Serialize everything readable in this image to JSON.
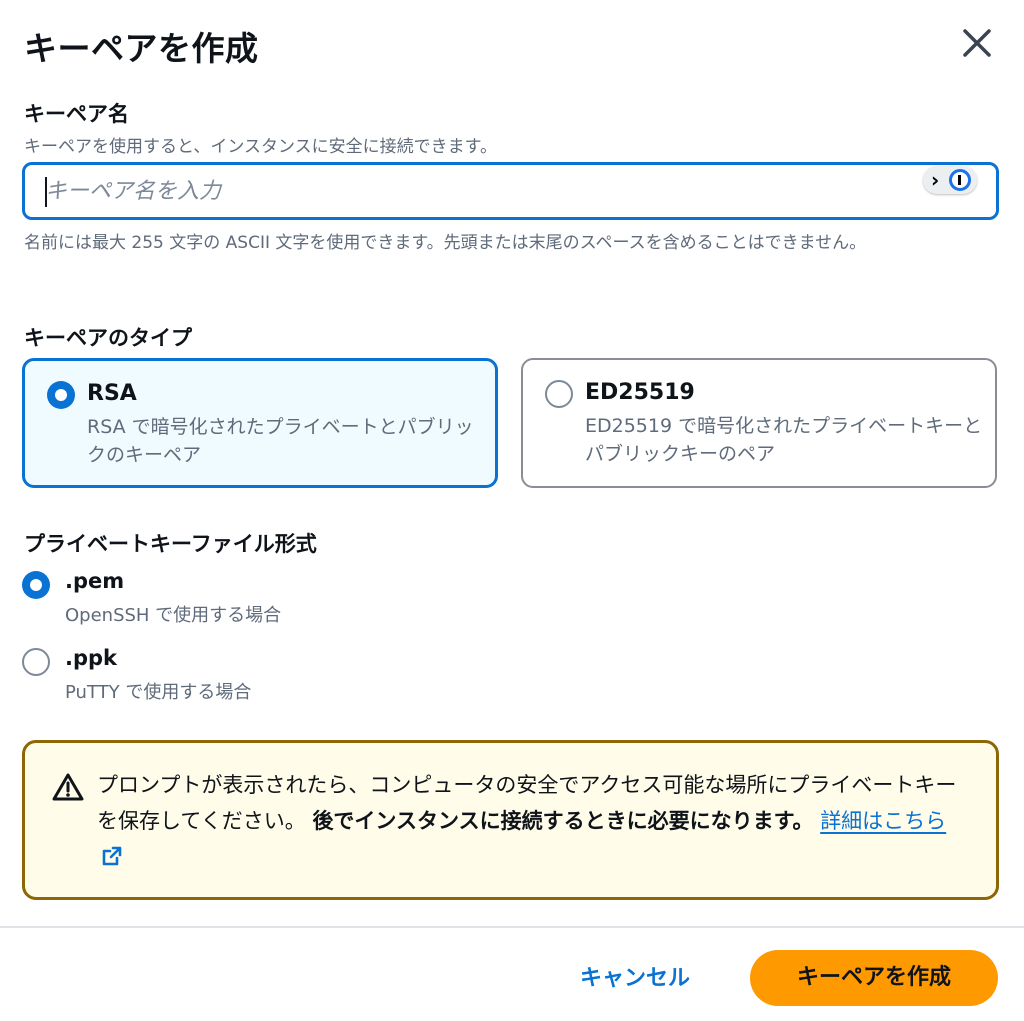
{
  "dialog": {
    "title": "キーペアを作成",
    "close_icon": "close-icon"
  },
  "key_name": {
    "label": "キーペア名",
    "description": "キーペアを使用すると、インスタンスに安全に接続できます。",
    "value": "",
    "placeholder": "キーペア名を入力",
    "constraint": "名前には最大 255 文字の ASCII 文字を使用できます。先頭または末尾のスペースを含めることはできません。"
  },
  "key_type": {
    "label": "キーペアのタイプ",
    "selected": "RSA",
    "options": [
      {
        "title": "RSA",
        "description": "RSA で暗号化されたプライベートとパブリックのキーペア"
      },
      {
        "title": "ED25519",
        "description": "ED25519 で暗号化されたプライベートキーとパブリックキーのペア"
      }
    ]
  },
  "file_format": {
    "label": "プライベートキーファイル形式",
    "selected": ".pem",
    "options": [
      {
        "title": ".pem",
        "description": "OpenSSH で使用する場合"
      },
      {
        "title": ".ppk",
        "description": "PuTTY で使用する場合"
      }
    ]
  },
  "alert": {
    "icon": "warning-icon",
    "text": "プロンプトが表示されたら、コンピュータの安全でアクセス可能な場所にプライベートキーを保存してください。",
    "bold_text": "後でインスタンスに接続するときに必要になります。",
    "link_label": "詳細はこちら",
    "link_icon": "external-link-icon"
  },
  "footer": {
    "cancel_label": "キャンセル",
    "create_label": "キーペアを作成"
  },
  "colors": {
    "primary": "#0972d3",
    "create_button": "#ff9900",
    "alert_border": "#8d6605",
    "alert_background": "#fffce9",
    "selected_tile_background": "#f0fbff"
  }
}
